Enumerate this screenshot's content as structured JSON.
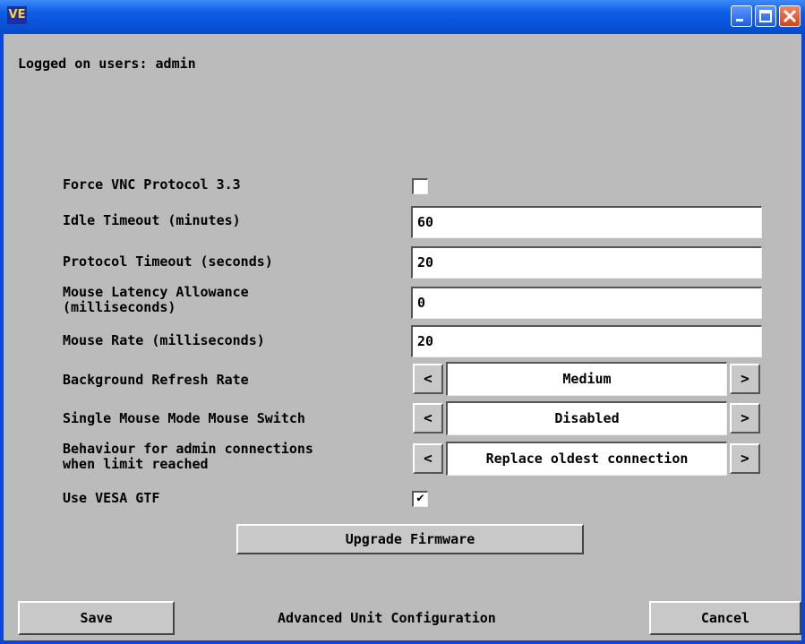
{
  "window": {
    "icon_text": "VE",
    "buttons": [
      "minimize",
      "maximize",
      "close"
    ]
  },
  "logged_on": "Logged on users:  admin",
  "settings": {
    "force_vnc": {
      "label": "Force VNC Protocol 3.3",
      "checked": false
    },
    "idle_timeout": {
      "label": "Idle Timeout (minutes)",
      "value": "60"
    },
    "protocol_timeout": {
      "label": "Protocol Timeout (seconds)",
      "value": "20"
    },
    "mouse_latency": {
      "label_line1": "Mouse Latency Allowance",
      "label_line2": "(milliseconds)",
      "value": "0"
    },
    "mouse_rate": {
      "label": "Mouse Rate (milliseconds)",
      "value": "20"
    },
    "background_refresh": {
      "label": "Background Refresh Rate",
      "value": "Medium",
      "prev": "<",
      "next": ">"
    },
    "single_mouse": {
      "label": "Single Mouse Mode Mouse Switch",
      "value": "Disabled",
      "prev": "<",
      "next": ">"
    },
    "admin_behaviour": {
      "label_line1": "Behaviour for admin connections",
      "label_line2": "when limit reached",
      "value": "Replace oldest connection",
      "prev": "<",
      "next": ">"
    },
    "vesa_gtf": {
      "label": "Use VESA GTF",
      "checked": true,
      "check_glyph": "✔"
    }
  },
  "upgrade_button": "Upgrade Firmware",
  "footer": {
    "save": "Save",
    "title": "Advanced Unit Configuration",
    "cancel": "Cancel"
  },
  "colors": {
    "titlebar": "#0a4fd6",
    "client_bg": "#bbbbbb",
    "field_bg": "#ffffff"
  }
}
